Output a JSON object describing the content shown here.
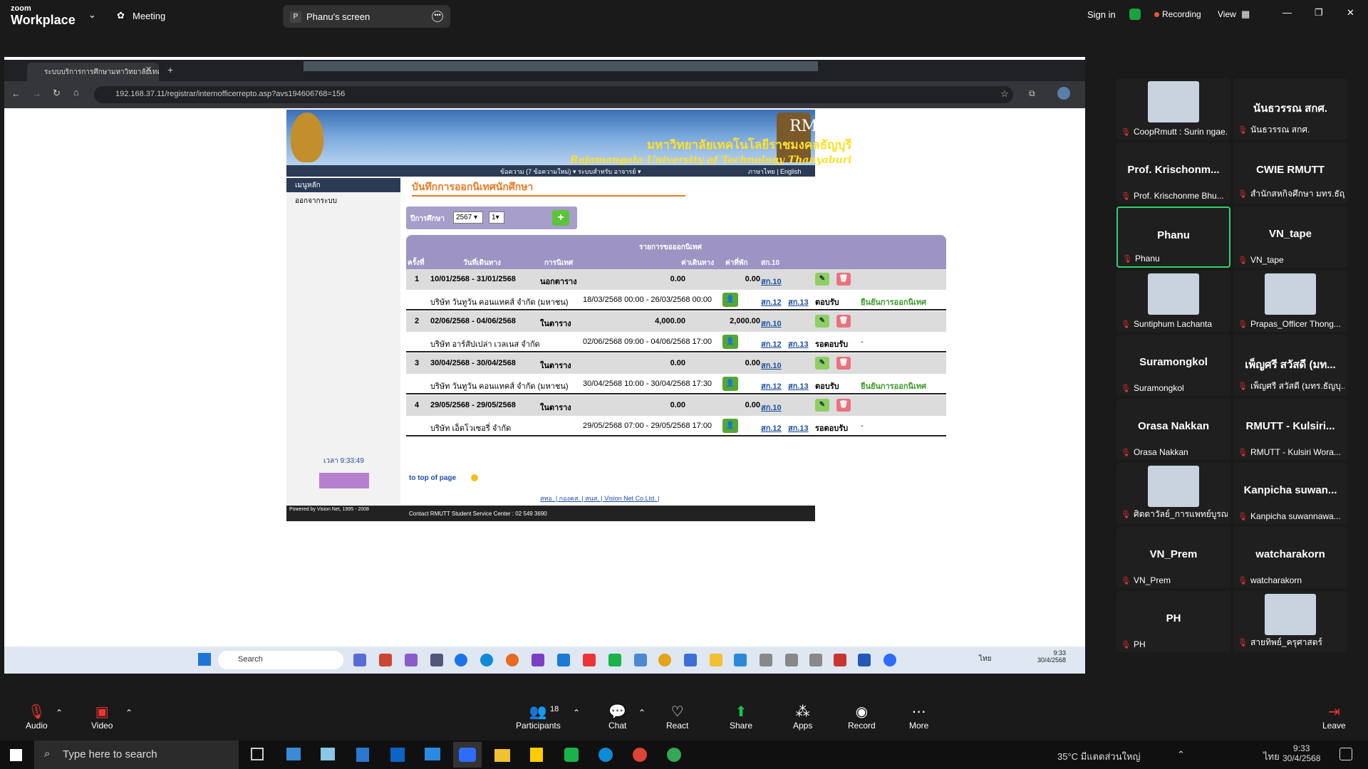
{
  "zoom": {
    "brand_top": "zoom",
    "brand_bottom": "Workplace",
    "meeting_label": "Meeting",
    "share_avatar": "P",
    "share_label": "Phanu's screen",
    "sign_in": "Sign in",
    "recording": "Recording",
    "view": "View"
  },
  "browser": {
    "tab_title": "ระบบบริการการศึกษามหาวิทยาลัยเทคโน",
    "url": "192.168.37.11/registrar/internofficerrepto.asp?avs194606768=156"
  },
  "site": {
    "banner_en": "RMUTT",
    "banner_th": "มหาวิทยาลัยเทคโนโลยีราชมงคลธัญบุรี",
    "banner_en2": "Rajamangala University of Technology Thanyaburi",
    "menu_left": "ข้อความ (7 ข้อความใหม่) ▾   ระบบสำหรับ อาจารย์ ▾",
    "menu_right": "ภาษาไทย | English",
    "nav_main": "เมนูหลัก",
    "nav_logout": "ออกจากระบบ",
    "time": "เวลา 9:33:49",
    "section_title": "บันทึกการออกนิเทศนักศึกษา",
    "filter_label": "ปีการศึกษา",
    "year": "2567",
    "term": "1",
    "add": "+",
    "table_title": "รายการขอออกนิเทศ",
    "headers": {
      "no": "ครั้งที่",
      "date": "วันที่เดินทาง",
      "type": "การนิเทศ",
      "cost": "ค่าเดินทาง",
      "hotel": "ค่าที่พัก",
      "form": "สก.10"
    },
    "rows": [
      {
        "no": "1",
        "date": "10/01/2568 - 31/01/2568",
        "type": "นอกตาราง",
        "cost": "0.00",
        "hotel": "0.00",
        "form": "สก.10",
        "company": "บริษัท วันทูวัน คอนแทคส์ จำกัด (มหาชน)",
        "period": "18/03/2568 00:00 - 26/03/2568 00:00",
        "f12": "สก.12",
        "f13": "สก.13",
        "status": "ตอบรับ",
        "note": "ยืนยันการออกนิเทศ"
      },
      {
        "no": "2",
        "date": "02/06/2568 - 04/06/2568",
        "type": "ในตาราง",
        "cost": "4,000.00",
        "hotel": "2,000.00",
        "form": "สก.10",
        "company": "บริษัท อาร์สัปเปล่า เวลเนส จำกัด",
        "period": "02/06/2568 09:00 - 04/06/2568 17:00",
        "f12": "สก.12",
        "f13": "สก.13",
        "status": "รอตอบรับ",
        "note": "-"
      },
      {
        "no": "3",
        "date": "30/04/2568 - 30/04/2568",
        "type": "ในตาราง",
        "cost": "0.00",
        "hotel": "0.00",
        "form": "สก.10",
        "company": "บริษัท วันทูวัน คอนแทคส์ จำกัด (มหาชน)",
        "period": "30/04/2568 10:00 - 30/04/2568 17:30",
        "f12": "สก.12",
        "f13": "สก.13",
        "status": "ตอบรับ",
        "note": "ยืนยันการออกนิเทศ"
      },
      {
        "no": "4",
        "date": "29/05/2568 - 29/05/2568",
        "type": "ในตาราง",
        "cost": "0.00",
        "hotel": "0.00",
        "form": "สก.10",
        "company": "บริษัท เอ็ดโวเซอรี่ จำกัด",
        "period": "29/05/2568 07:00 - 29/05/2568 17:00",
        "f12": "สก.12",
        "f13": "สก.13",
        "status": "รอตอบรับ",
        "note": "-"
      }
    ],
    "to_top": "to top of page",
    "links": "สทอ. | กองคส. | สนส. | Vision Net Co.Ltd. |",
    "powered": "Powered by Vision Net, 1995 - 2008",
    "contact": "Contact RMUTT Student Service Center : 02 549 3690"
  },
  "inner_taskbar": {
    "search": "Search",
    "time": "9:33",
    "date": "30/4/2568",
    "lang": "ไทย"
  },
  "participants": [
    {
      "name": "",
      "label": "CoopRmutt : Surin ngae..."
    },
    {
      "name": "นันธวรรณ สกศ.",
      "label": "นันธวรรณ สกศ."
    },
    {
      "name": "Prof. Krischonm...",
      "label": "Prof. Krischonme Bhu..."
    },
    {
      "name": "CWIE RMUTT",
      "label": "สำนักสหกิจศึกษา มทร.ธัญบุรี"
    },
    {
      "name": "Phanu",
      "label": "Phanu"
    },
    {
      "name": "VN_tape",
      "label": "VN_tape"
    },
    {
      "name": "",
      "label": "Suntiphum Lachanta"
    },
    {
      "name": "",
      "label": "Prapas_Officer Thong..."
    },
    {
      "name": "Suramongkol",
      "label": "Suramongkol"
    },
    {
      "name": "เพ็ญศรี สวัสดี (มท...",
      "label": "เพ็ญศรี สวัสดี (มทร.ธัญบุ..."
    },
    {
      "name": "Orasa Nakkan",
      "label": "Orasa Nakkan"
    },
    {
      "name": "RMUTT - Kulsiri...",
      "label": "RMUTT - Kulsiri Wora..."
    },
    {
      "name": "",
      "label": "ศิตดาวัลย์_การแพทย์บูรณ..."
    },
    {
      "name": "Kanpicha suwan...",
      "label": "Kanpicha suwannawa..."
    },
    {
      "name": "VN_Prem",
      "label": "VN_Prem"
    },
    {
      "name": "watcharakorn",
      "label": "watcharakorn"
    },
    {
      "name": "PH",
      "label": "PH"
    },
    {
      "name": "",
      "label": "สายทิพย์_ครุศาสตร์"
    }
  ],
  "controls": {
    "audio": "Audio",
    "video": "Video",
    "participants": "Participants",
    "participants_count": "18",
    "chat": "Chat",
    "react": "React",
    "share": "Share",
    "apps": "Apps",
    "record": "Record",
    "more": "More",
    "leave": "Leave"
  },
  "taskbar": {
    "search": "Type here to search",
    "weather": "35°C มีแดดส่วนใหญ่",
    "lang": "ไทย",
    "time": "9:33",
    "date": "30/4/2568"
  }
}
